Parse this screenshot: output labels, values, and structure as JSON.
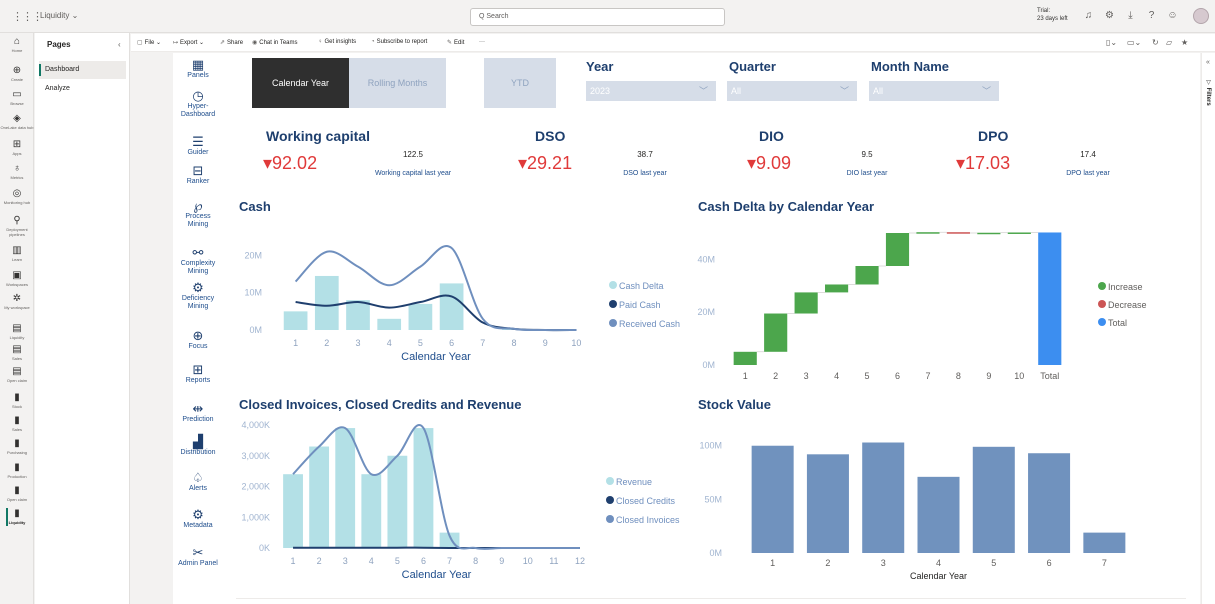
{
  "topbar": {
    "workspace": "Liquidity ⌄",
    "search_placeholder": "Q Search",
    "trial_line1": "Trial:",
    "trial_line2": "23 days left"
  },
  "rail": [
    {
      "label": "Home",
      "icon": "home-icon"
    },
    {
      "label": "Create",
      "icon": "plus-icon"
    },
    {
      "label": "Browse",
      "icon": "folder-icon"
    },
    {
      "label": "OneLake data hub",
      "icon": "onelake-icon"
    },
    {
      "label": "Apps",
      "icon": "apps-icon"
    },
    {
      "label": "Metrics",
      "icon": "trophy-icon"
    },
    {
      "label": "Monitoring hub",
      "icon": "monitor-icon"
    },
    {
      "label": "Deployment pipelines",
      "icon": "rocket-icon"
    },
    {
      "label": "Learn",
      "icon": "book-icon"
    },
    {
      "label": "Workspaces",
      "icon": "workspaces-icon"
    },
    {
      "label": "My workspace",
      "icon": "my-workspace-icon"
    },
    {
      "label": "Liquidity",
      "icon": "report-icon"
    },
    {
      "label": "Sales",
      "icon": "report-icon"
    },
    {
      "label": "Open claim",
      "icon": "report-icon"
    },
    {
      "label": "Stock",
      "icon": "bar-chart-icon"
    },
    {
      "label": "Sales",
      "icon": "bar-chart-icon"
    },
    {
      "label": "Purchasing",
      "icon": "bar-chart-icon"
    },
    {
      "label": "Production",
      "icon": "bar-chart-icon"
    },
    {
      "label": "Open claim",
      "icon": "bar-chart-icon"
    },
    {
      "label": "Liquidity",
      "icon": "bar-chart-icon"
    }
  ],
  "pages": {
    "title": "Pages",
    "items": [
      "Dashboard",
      "Analyze"
    ]
  },
  "toolbar": {
    "file": "File ⌄",
    "export": "Export ⌄",
    "share": "Share",
    "teams": "Chat in Teams",
    "insights": "Get insights",
    "subscribe": "Subscribe to report",
    "edit": "Edit",
    "more": "···"
  },
  "nav": [
    {
      "label": "Panels",
      "icon": "panels-icon"
    },
    {
      "label": "Hyper-Dashboard",
      "icon": "gauge-icon"
    },
    {
      "label": "Guider",
      "icon": "guider-icon"
    },
    {
      "label": "Ranker",
      "icon": "ranker-icon"
    },
    {
      "label": "Process Mining",
      "icon": "process-mining-icon"
    },
    {
      "label": "Complexity Mining",
      "icon": "complexity-mining-icon"
    },
    {
      "label": "Deficiency Mining",
      "icon": "deficiency-mining-icon"
    },
    {
      "label": "Focus",
      "icon": "focus-icon"
    },
    {
      "label": "Reports",
      "icon": "reports-icon"
    },
    {
      "label": "Prediction",
      "icon": "prediction-icon"
    },
    {
      "label": "Distribution",
      "icon": "distribution-icon"
    },
    {
      "label": "Alerts",
      "icon": "bell-icon"
    },
    {
      "label": "Metadata",
      "icon": "gear-icon"
    },
    {
      "label": "Admin Panel",
      "icon": "tools-icon"
    }
  ],
  "selectors": {
    "calendar_year": "Calendar Year",
    "rolling_months": "Rolling Months",
    "ytd": "YTD"
  },
  "slicers": {
    "year": {
      "title": "Year",
      "value": "2023"
    },
    "quarter": {
      "title": "Quarter",
      "value": "All"
    },
    "month": {
      "title": "Month Name",
      "value": "All"
    }
  },
  "kpis": [
    {
      "title": "Working capital",
      "value": "▾92.02",
      "last_year": "122.5",
      "last_year_label": "Working capital last year"
    },
    {
      "title": "DSO",
      "value": "▾29.21",
      "last_year": "38.7",
      "last_year_label": "DSO last year"
    },
    {
      "title": "DIO",
      "value": "▾9.09",
      "last_year": "9.5",
      "last_year_label": "DIO last year"
    },
    {
      "title": "DPO",
      "value": "▾17.03",
      "last_year": "17.4",
      "last_year_label": "DPO last year"
    }
  ],
  "colors": {
    "accent": "#1e3f6e",
    "negative": "#e03a3a",
    "light_bar": "#b3e0e6",
    "dark_line": "#1f3f6e",
    "mid_line": "#6f8fbe",
    "increase": "#4ca64c",
    "decrease": "#cc5555",
    "total": "#3c8ef0",
    "stock_bar": "#7092be"
  },
  "chart_data": [
    {
      "id": "cash",
      "type": "bar",
      "title": "Cash",
      "xlabel": "Calendar Year",
      "categories": [
        "1",
        "2",
        "3",
        "4",
        "5",
        "6",
        "7",
        "8",
        "9",
        "10"
      ],
      "y_ticks": [
        "0M",
        "10M",
        "20M"
      ],
      "ylim": [
        0,
        22
      ],
      "legend_position": "right",
      "series": [
        {
          "name": "Cash Delta",
          "kind": "bar",
          "values": [
            5,
            14.5,
            8,
            3,
            7,
            12.5,
            0,
            0.3,
            0,
            0
          ]
        },
        {
          "name": "Paid Cash",
          "kind": "line",
          "values": [
            7.5,
            6.5,
            7.5,
            6,
            7.5,
            9,
            2,
            0.3,
            0,
            0
          ]
        },
        {
          "name": "Received Cash",
          "kind": "line",
          "values": [
            13,
            21,
            17,
            12,
            17,
            22,
            3,
            0.3,
            0,
            0
          ]
        }
      ]
    },
    {
      "id": "cash-delta",
      "type": "bar",
      "title": "Cash Delta by Calendar Year",
      "categories": [
        "1",
        "2",
        "3",
        "4",
        "5",
        "6",
        "7",
        "8",
        "9",
        "10",
        "Total"
      ],
      "y_ticks": [
        "0M",
        "20M",
        "40M"
      ],
      "ylim": [
        0,
        50
      ],
      "legend_position": "right",
      "legend": [
        "Increase",
        "Decrease",
        "Total"
      ],
      "deltas": [
        5,
        14.5,
        8,
        3,
        7,
        12.5,
        0.3,
        -0.3,
        0.1,
        0.1
      ],
      "total": 50.2
    },
    {
      "id": "invoices",
      "type": "bar",
      "title": "Closed Invoices, Closed Credits and Revenue",
      "xlabel": "Calendar Year",
      "categories": [
        "1",
        "2",
        "3",
        "4",
        "5",
        "6",
        "7",
        "8",
        "9",
        "10",
        "11",
        "12"
      ],
      "y_ticks": [
        "0K",
        "1,000K",
        "2,000K",
        "3,000K",
        "4,000K"
      ],
      "ylim": [
        0,
        4000
      ],
      "legend_position": "right",
      "series": [
        {
          "name": "Revenue",
          "kind": "bar",
          "values": [
            2400,
            3300,
            3900,
            2400,
            3000,
            3900,
            500,
            0,
            0,
            0,
            0,
            0
          ]
        },
        {
          "name": "Closed Credits",
          "kind": "line",
          "values": [
            10,
            10,
            10,
            10,
            10,
            10,
            0,
            0,
            0,
            0,
            0,
            0
          ]
        },
        {
          "name": "Closed Invoices",
          "kind": "line",
          "values": [
            2400,
            3300,
            3900,
            2400,
            3000,
            3900,
            400,
            0,
            0,
            0,
            0,
            0
          ]
        }
      ]
    },
    {
      "id": "stock",
      "type": "bar",
      "title": "Stock Value",
      "xlabel": "Calendar Year",
      "categories": [
        "1",
        "2",
        "3",
        "4",
        "5",
        "6",
        "7"
      ],
      "y_ticks": [
        "0M",
        "50M",
        "100M"
      ],
      "ylim": [
        0,
        110
      ],
      "values": [
        100,
        92,
        103,
        71,
        99,
        93,
        19
      ]
    }
  ]
}
